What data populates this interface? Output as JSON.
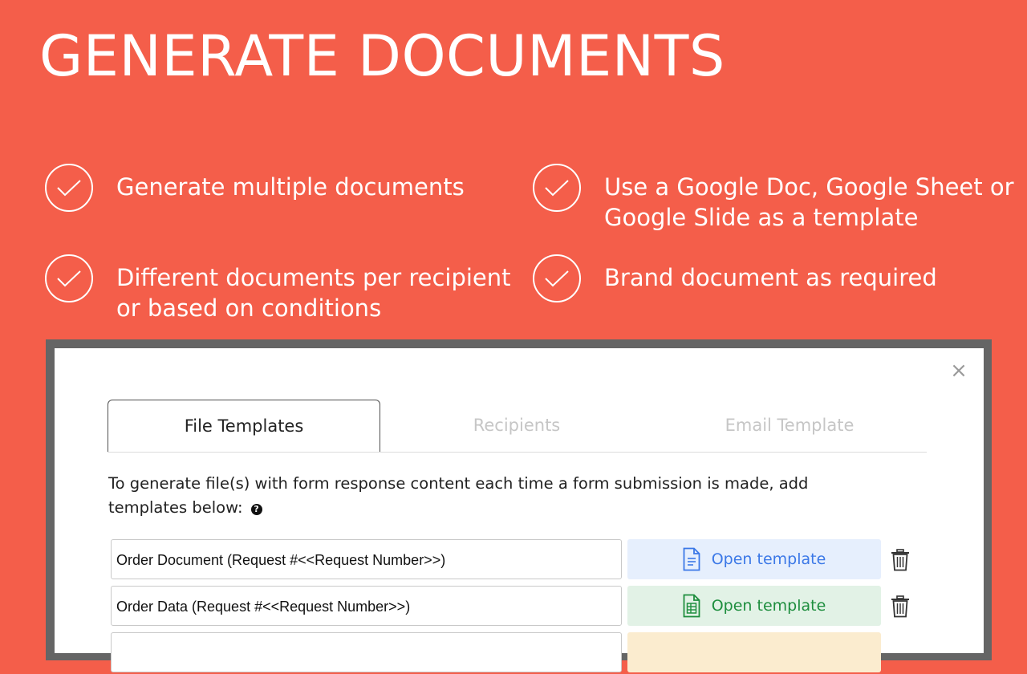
{
  "hero": {
    "title": "GENERATE DOCUMENTS"
  },
  "features": [
    {
      "text": "Generate multiple documents"
    },
    {
      "text": "Use a Google Doc, Google Sheet or\nGoogle Slide as a template"
    },
    {
      "text": "Different documents per recipient\nor based on conditions"
    },
    {
      "text": "Brand document as required"
    }
  ],
  "dialog": {
    "close_icon": "close-icon",
    "tabs": [
      {
        "label": "File Templates",
        "active": true
      },
      {
        "label": "Recipients",
        "active": false
      },
      {
        "label": "Email Template",
        "active": false
      }
    ],
    "intro_text": "To generate file(s) with form response content each time a form submission is made, add templates below:",
    "help_icon": "help-icon",
    "templates": [
      {
        "name": "Order Document (Request #<<Request Number>>)",
        "button_label": "Open template",
        "type": "doc",
        "icon": "google-doc-icon"
      },
      {
        "name": "Order Data (Request #<<Request Number>>)",
        "button_label": "Open template",
        "type": "sheet",
        "icon": "google-sheet-icon"
      }
    ],
    "delete_icon": "trash-icon"
  },
  "colors": {
    "background": "#f45e4a",
    "doc_accent": "#3b78e7",
    "sheet_accent": "#1e8e3e",
    "slide_accent": "#c88a00"
  }
}
